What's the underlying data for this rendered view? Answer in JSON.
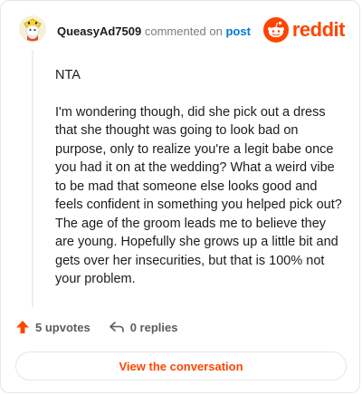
{
  "comment": {
    "username": "QueasyAd7509",
    "action_text": "commented on",
    "target_link": "post",
    "paragraphs": [
      "NTA",
      "I'm wondering though, did she pick out a dress that she thought was going to look bad on purpose, only to realize you're a legit babe once you had it on at the wedding? What a weird vibe to be mad that someone else looks good and feels confident in something you helped pick out? The age of the groom leads me to believe they are young. Hopefully she grows up a little bit and gets over her insecurities, but that is 100% not your problem."
    ]
  },
  "brand": {
    "wordmark": "reddit",
    "color": "#ff4500",
    "icon": "reddit-snoo-icon"
  },
  "footer": {
    "upvotes_label": "5 upvotes",
    "replies_label": "0 replies",
    "upvote_icon": "upvote-arrow-icon",
    "reply_icon": "reply-arrow-icon"
  },
  "cta": {
    "label": "View the conversation"
  },
  "colors": {
    "accent": "#ff4500",
    "link": "#0079d3",
    "muted": "#7c7c7c"
  }
}
